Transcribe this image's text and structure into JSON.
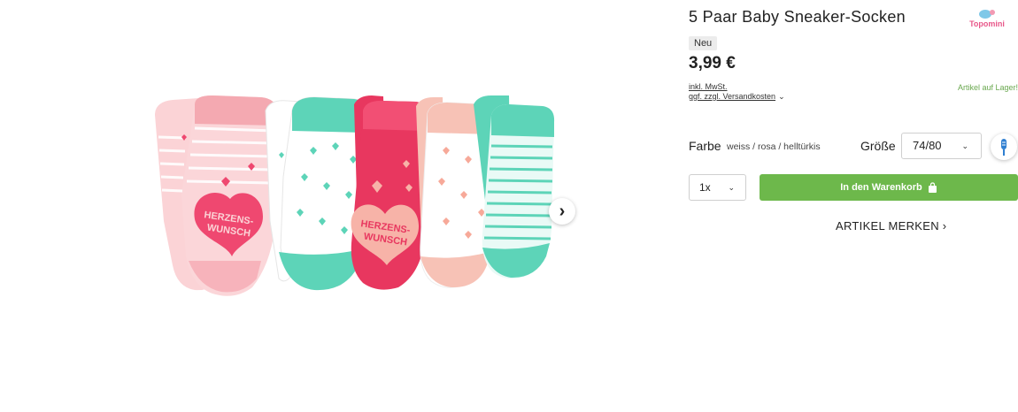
{
  "product": {
    "title": "5 Paar Baby Sneaker-Socken",
    "badge": "Neu",
    "price": "3,99 €",
    "tax_note": "inkl. MwSt.",
    "shipping_link": "ggf. zzgl. Versandkosten",
    "stock_status": "Artikel auf Lager!",
    "sock_print_text": "HERZENS- WUNSCH"
  },
  "brand": {
    "logo_text": "Topomini"
  },
  "options": {
    "color_label": "Farbe",
    "color_value": "weiss / rosa / helltürkis",
    "size_label": "Größe",
    "size_value": "74/80",
    "quantity_value": "1x"
  },
  "actions": {
    "add_to_cart": "In den Warenkorb",
    "wishlist": "ARTIKEL MERKEN ›"
  },
  "icons": {
    "next": "chevron-right-icon",
    "dropdown": "chevron-down-icon",
    "size_guide": "size-guide-icon",
    "cart": "shopping-bag-icon"
  },
  "colors": {
    "accent_green": "#6db84b",
    "stock_green": "#6aa84f",
    "sock_pink": "#f6b8bf",
    "sock_red": "#e8375f",
    "sock_turquoise": "#5dd4b8",
    "sock_peach": "#f7c2b6"
  }
}
